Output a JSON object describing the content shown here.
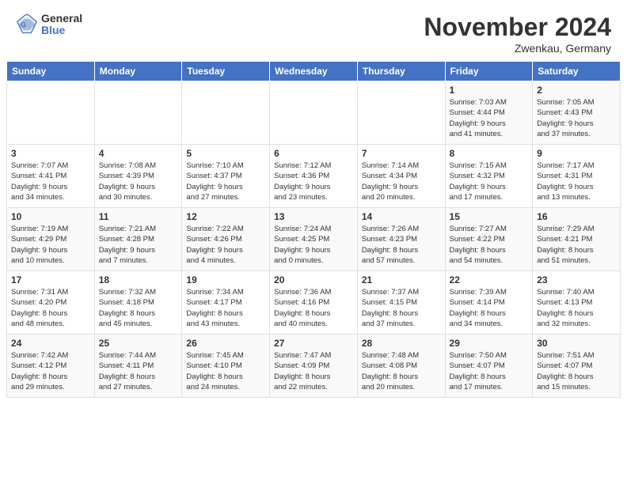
{
  "header": {
    "logo_general": "General",
    "logo_blue": "Blue",
    "month_title": "November 2024",
    "subtitle": "Zwenkau, Germany"
  },
  "calendar": {
    "days_of_week": [
      "Sunday",
      "Monday",
      "Tuesday",
      "Wednesday",
      "Thursday",
      "Friday",
      "Saturday"
    ],
    "weeks": [
      [
        {
          "day": "",
          "info": ""
        },
        {
          "day": "",
          "info": ""
        },
        {
          "day": "",
          "info": ""
        },
        {
          "day": "",
          "info": ""
        },
        {
          "day": "",
          "info": ""
        },
        {
          "day": "1",
          "info": "Sunrise: 7:03 AM\nSunset: 4:44 PM\nDaylight: 9 hours\nand 41 minutes."
        },
        {
          "day": "2",
          "info": "Sunrise: 7:05 AM\nSunset: 4:43 PM\nDaylight: 9 hours\nand 37 minutes."
        }
      ],
      [
        {
          "day": "3",
          "info": "Sunrise: 7:07 AM\nSunset: 4:41 PM\nDaylight: 9 hours\nand 34 minutes."
        },
        {
          "day": "4",
          "info": "Sunrise: 7:08 AM\nSunset: 4:39 PM\nDaylight: 9 hours\nand 30 minutes."
        },
        {
          "day": "5",
          "info": "Sunrise: 7:10 AM\nSunset: 4:37 PM\nDaylight: 9 hours\nand 27 minutes."
        },
        {
          "day": "6",
          "info": "Sunrise: 7:12 AM\nSunset: 4:36 PM\nDaylight: 9 hours\nand 23 minutes."
        },
        {
          "day": "7",
          "info": "Sunrise: 7:14 AM\nSunset: 4:34 PM\nDaylight: 9 hours\nand 20 minutes."
        },
        {
          "day": "8",
          "info": "Sunrise: 7:15 AM\nSunset: 4:32 PM\nDaylight: 9 hours\nand 17 minutes."
        },
        {
          "day": "9",
          "info": "Sunrise: 7:17 AM\nSunset: 4:31 PM\nDaylight: 9 hours\nand 13 minutes."
        }
      ],
      [
        {
          "day": "10",
          "info": "Sunrise: 7:19 AM\nSunset: 4:29 PM\nDaylight: 9 hours\nand 10 minutes."
        },
        {
          "day": "11",
          "info": "Sunrise: 7:21 AM\nSunset: 4:28 PM\nDaylight: 9 hours\nand 7 minutes."
        },
        {
          "day": "12",
          "info": "Sunrise: 7:22 AM\nSunset: 4:26 PM\nDaylight: 9 hours\nand 4 minutes."
        },
        {
          "day": "13",
          "info": "Sunrise: 7:24 AM\nSunset: 4:25 PM\nDaylight: 9 hours\nand 0 minutes."
        },
        {
          "day": "14",
          "info": "Sunrise: 7:26 AM\nSunset: 4:23 PM\nDaylight: 8 hours\nand 57 minutes."
        },
        {
          "day": "15",
          "info": "Sunrise: 7:27 AM\nSunset: 4:22 PM\nDaylight: 8 hours\nand 54 minutes."
        },
        {
          "day": "16",
          "info": "Sunrise: 7:29 AM\nSunset: 4:21 PM\nDaylight: 8 hours\nand 51 minutes."
        }
      ],
      [
        {
          "day": "17",
          "info": "Sunrise: 7:31 AM\nSunset: 4:20 PM\nDaylight: 8 hours\nand 48 minutes."
        },
        {
          "day": "18",
          "info": "Sunrise: 7:32 AM\nSunset: 4:18 PM\nDaylight: 8 hours\nand 45 minutes."
        },
        {
          "day": "19",
          "info": "Sunrise: 7:34 AM\nSunset: 4:17 PM\nDaylight: 8 hours\nand 43 minutes."
        },
        {
          "day": "20",
          "info": "Sunrise: 7:36 AM\nSunset: 4:16 PM\nDaylight: 8 hours\nand 40 minutes."
        },
        {
          "day": "21",
          "info": "Sunrise: 7:37 AM\nSunset: 4:15 PM\nDaylight: 8 hours\nand 37 minutes."
        },
        {
          "day": "22",
          "info": "Sunrise: 7:39 AM\nSunset: 4:14 PM\nDaylight: 8 hours\nand 34 minutes."
        },
        {
          "day": "23",
          "info": "Sunrise: 7:40 AM\nSunset: 4:13 PM\nDaylight: 8 hours\nand 32 minutes."
        }
      ],
      [
        {
          "day": "24",
          "info": "Sunrise: 7:42 AM\nSunset: 4:12 PM\nDaylight: 8 hours\nand 29 minutes."
        },
        {
          "day": "25",
          "info": "Sunrise: 7:44 AM\nSunset: 4:11 PM\nDaylight: 8 hours\nand 27 minutes."
        },
        {
          "day": "26",
          "info": "Sunrise: 7:45 AM\nSunset: 4:10 PM\nDaylight: 8 hours\nand 24 minutes."
        },
        {
          "day": "27",
          "info": "Sunrise: 7:47 AM\nSunset: 4:09 PM\nDaylight: 8 hours\nand 22 minutes."
        },
        {
          "day": "28",
          "info": "Sunrise: 7:48 AM\nSunset: 4:08 PM\nDaylight: 8 hours\nand 20 minutes."
        },
        {
          "day": "29",
          "info": "Sunrise: 7:50 AM\nSunset: 4:07 PM\nDaylight: 8 hours\nand 17 minutes."
        },
        {
          "day": "30",
          "info": "Sunrise: 7:51 AM\nSunset: 4:07 PM\nDaylight: 8 hours\nand 15 minutes."
        }
      ]
    ]
  }
}
